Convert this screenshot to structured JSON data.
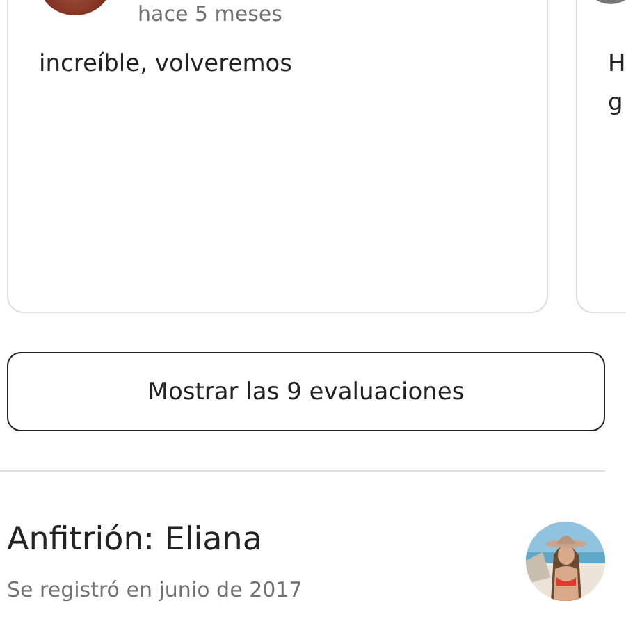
{
  "reviews": [
    {
      "date": "hace 5 meses",
      "text": "increíble, volveremos"
    },
    {
      "text_lines": [
        "H",
        "g"
      ]
    }
  ],
  "show_all_button": "Mostrar las 9 evaluaciones",
  "host": {
    "title": "Anfitrión: Eliana",
    "joined": "Se registró en junio de 2017"
  }
}
